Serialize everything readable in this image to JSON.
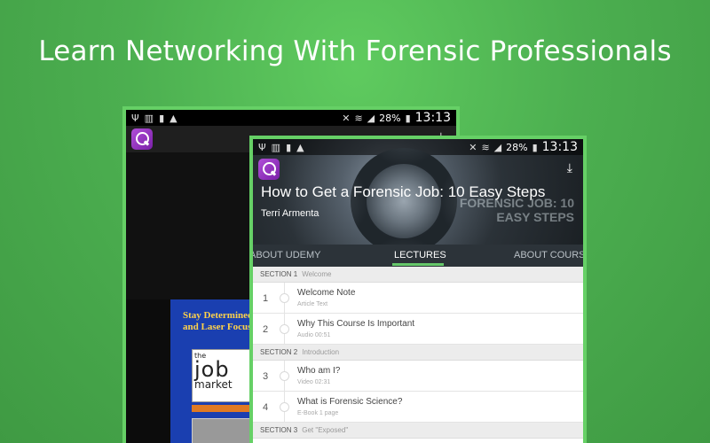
{
  "headline": "Learn Networking With Forensic Professionals",
  "status_bar": {
    "battery": "28%",
    "time": "13:13"
  },
  "back_device": {
    "slide_text": "Stay Determined and Laser Focused",
    "logo": {
      "the": "the",
      "job": "job",
      "market": "market"
    }
  },
  "course": {
    "title": "How to Get a Forensic Job: 10 Easy Steps",
    "author": "Terri  Armenta",
    "hero_overlay": "FORENSIC JOB: 10 EASY STEPS"
  },
  "tabs": [
    {
      "label": "About Udemy"
    },
    {
      "label": "Lectures"
    },
    {
      "label": "About Course"
    }
  ],
  "sections": [
    {
      "label": "SECTION 1",
      "name": "Welcome"
    },
    {
      "label": "SECTION 2",
      "name": "Introduction"
    },
    {
      "label": "SECTION 3",
      "name": "Get \"Exposed\""
    }
  ],
  "lectures": [
    {
      "num": "1",
      "title": "Welcome Note",
      "sub": "Article Text"
    },
    {
      "num": "2",
      "title": "Why This Course Is Important",
      "sub": "Audio 00:51"
    },
    {
      "num": "3",
      "title": "Who am I?",
      "sub": "Video 02:31"
    },
    {
      "num": "4",
      "title": "What is Forensic Science?",
      "sub": "E-Book 1 page"
    }
  ],
  "colors": {
    "background": "#4caf50",
    "accent": "#66c86a",
    "frame": "#66d066"
  }
}
